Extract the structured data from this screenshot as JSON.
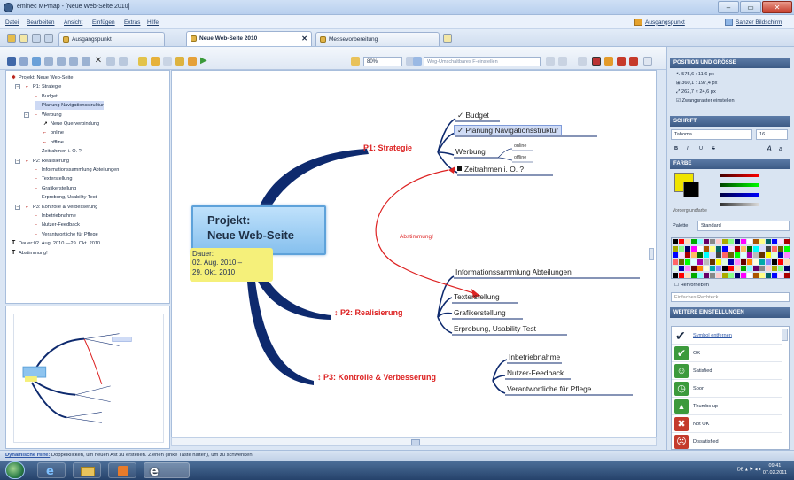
{
  "window": {
    "title": "eminec MPmap - [Neue Web-Seite 2010]"
  },
  "menu": {
    "items": [
      "Datei",
      "Bearbeiten",
      "Ansicht",
      "Einfügen",
      "Extras",
      "Hilfe"
    ],
    "right_links": [
      "Ausgangspunkt",
      "Sanzer Bildschirm"
    ]
  },
  "tabs": [
    {
      "label": "Ausgangspunkt",
      "active": false
    },
    {
      "label": "Neue Web-Seite 2010",
      "active": true
    },
    {
      "label": "Messevorbereitung",
      "active": false
    }
  ],
  "toolbar": {
    "zoom": "80%",
    "search_placeholder": "Weg-Umschaltbares F-einstellen"
  },
  "outline": {
    "items": [
      {
        "text": "Projekt: Neue Web-Seite",
        "level": 0,
        "icon": "pin",
        "exp": ""
      },
      {
        "text": "P1: Strategie",
        "level": 1,
        "icon": "branch",
        "exp": "−"
      },
      {
        "text": "Budget",
        "level": 2,
        "icon": "branch",
        "exp": ""
      },
      {
        "text": "Planung Navigationsstruktur",
        "level": 2,
        "icon": "branch",
        "exp": "",
        "selected": true
      },
      {
        "text": "Werbung",
        "level": 2,
        "icon": "branch",
        "exp": "−"
      },
      {
        "text": "Neue Querverbindung",
        "level": 3,
        "icon": "arrow",
        "exp": ""
      },
      {
        "text": "online",
        "level": 3,
        "icon": "branch",
        "exp": ""
      },
      {
        "text": "offline",
        "level": 3,
        "icon": "branch",
        "exp": ""
      },
      {
        "text": "Zeitrahmen i. O. ?",
        "level": 2,
        "icon": "branch",
        "exp": ""
      },
      {
        "text": "P2: Realisierung",
        "level": 1,
        "icon": "branch",
        "exp": "−"
      },
      {
        "text": "Informationssammlung Abteilungen",
        "level": 2,
        "icon": "branch",
        "exp": ""
      },
      {
        "text": "Texterstellung",
        "level": 2,
        "icon": "branch",
        "exp": ""
      },
      {
        "text": "Grafikerstellung",
        "level": 2,
        "icon": "branch",
        "exp": ""
      },
      {
        "text": "Erprobung, Usability Test",
        "level": 2,
        "icon": "branch",
        "exp": ""
      },
      {
        "text": "P3: Kontrolle & Verbesserung",
        "level": 1,
        "icon": "branch",
        "exp": "−"
      },
      {
        "text": "Inbetriebnahme",
        "level": 2,
        "icon": "branch",
        "exp": ""
      },
      {
        "text": "Nutzer-Feedback",
        "level": 2,
        "icon": "branch",
        "exp": ""
      },
      {
        "text": "Verantwortliche für Pflege",
        "level": 2,
        "icon": "branch",
        "exp": ""
      },
      {
        "text": "Dauer:02. Aug. 2010 —29. Okt. 2010",
        "level": 0,
        "icon": "text",
        "exp": ""
      },
      {
        "text": "Abstimmung!",
        "level": 0,
        "icon": "text",
        "exp": ""
      }
    ]
  },
  "map": {
    "central_line1": "Projekt:",
    "central_line2": "Neue Web-Seite",
    "dauer_label": "Dauer:",
    "dauer_from": "02. Aug. 2010 –",
    "dauer_to": "29. Okt. 2010",
    "p1": "P1: Strategie",
    "p2": "↕ P2: Realisierung",
    "p3": "↕ P3: Kontrolle & Verbesserung",
    "budget": "✓ Budget",
    "planung": "✓ Planung Navigationsstruktur",
    "werbung": "Werbung",
    "online": "online",
    "offline": "offline",
    "zeitrahmen": "Zeitrahmen i. O. ?",
    "info": "Informationssammlung Abteilungen",
    "text": "Texterstellung",
    "grafik": "Grafikerstellung",
    "erprobung": "Erprobung, Usability Test",
    "inbetrieb": "Inbetriebnahme",
    "nutzer": "Nutzer-Feedback",
    "verantw": "Verantwortliche für Pflege",
    "relation": "Abstimmung!"
  },
  "panel": {
    "pos_header": "POSITION UND GRÖSSE",
    "pos_lines": [
      "575,6 : 11,6 px",
      "360,1 : 197,4 px",
      "262,7 × 24,6 px"
    ],
    "pos_check": "Zwangsraster einstellen",
    "font_header": "SCHRIFT",
    "font_name": "Tahoma",
    "font_size": "16",
    "style_buttons": [
      "B",
      "I",
      "U",
      "S"
    ],
    "color_header": "FARBE",
    "color_label": "Vordergrundfarbe",
    "palette_label": "Palette",
    "palette_value": "Standard",
    "transparent": "Hervorheben",
    "effect": "Einfaches Rechteck",
    "more_header": "WEITERE EINSTELLUNGEN",
    "icons": [
      {
        "label": "Symbol entfernen",
        "link": true
      },
      {
        "label": "OK"
      },
      {
        "label": "Satisfied"
      },
      {
        "label": "Soon"
      },
      {
        "label": "Thumbs up"
      },
      {
        "label": "Not OK"
      },
      {
        "label": "Dissatisfied"
      }
    ]
  },
  "status": {
    "link": "Dynamische Hilfe:",
    "text": "Doppelklicken, um neuen Ast zu erstellen. Ziehen (linke Taste halten), um zu schwenken"
  },
  "taskbar": {
    "time": "09:41",
    "date": "07.02.2011",
    "lang": "DE"
  },
  "colors": {
    "accent": "#d22222",
    "branch": "#0e2a6e",
    "central_fill": "#8ec4ef",
    "highlight": "#f5f07a"
  }
}
